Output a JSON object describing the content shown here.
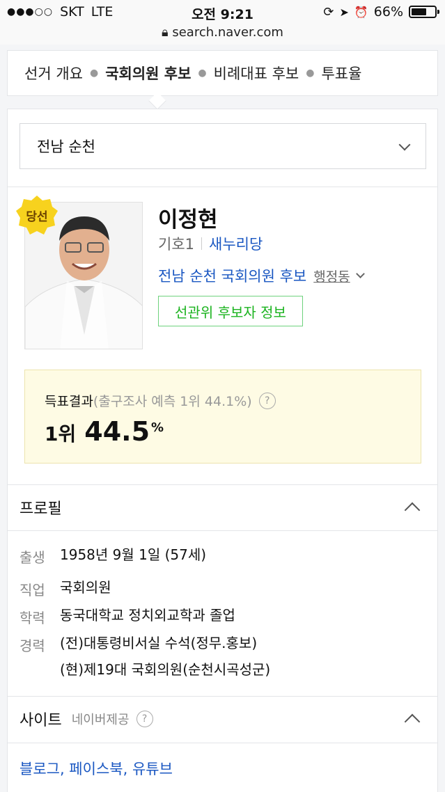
{
  "statusbar": {
    "carrier": "SKT",
    "network": "LTE",
    "time": "오전 9:21",
    "battery_text": "66%",
    "battery_level": 0.66,
    "url": "search.naver.com"
  },
  "tabs": [
    {
      "label": "선거 개요"
    },
    {
      "label": "국회의원 후보"
    },
    {
      "label": "비례대표 후보"
    },
    {
      "label": "투표율"
    }
  ],
  "region": {
    "selected": "전남 순천"
  },
  "candidate": {
    "badge": "당선",
    "name": "이정현",
    "number": "기호1",
    "party": "새누리당",
    "district": "전남 순천 국회의원 후보",
    "admin_link": "행정동",
    "info_button": "선관위 후보자 정보"
  },
  "result": {
    "label": "득표결과",
    "exit_poll": "(출구조사 예측 1위 44.1%)",
    "help": "?",
    "rank": "1위",
    "percent": "44.5",
    "percent_unit": "%"
  },
  "profile": {
    "title": "프로필",
    "rows": [
      {
        "label": "출생",
        "value": "1958년 9월 1일 (57세)"
      },
      {
        "label": "직업",
        "value": "국회의원"
      },
      {
        "label": "학력",
        "value": "동국대학교 정치외교학과 졸업"
      },
      {
        "label": "경력",
        "value": "(전)대통령비서실 수석(정무.홍보)",
        "value2": "(현)제19대 국회의원(순천시곡성군)"
      }
    ]
  },
  "site": {
    "title": "사이트",
    "provider": "네이버제공",
    "help": "?",
    "links": "블로그, 페이스북, 유튜브"
  },
  "colors": {
    "accent_blue": "#1a57c2",
    "green": "#1bb31f",
    "result_bg": "#fefbe4",
    "badge_yellow": "#f7d21e"
  }
}
